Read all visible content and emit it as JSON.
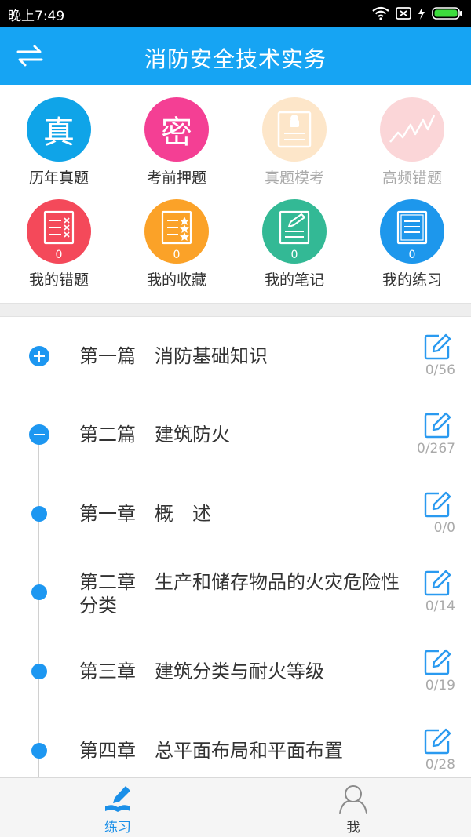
{
  "status_bar": {
    "time": "晚上7:49"
  },
  "header": {
    "title": "消防安全技术实务",
    "switch_icon": "swap-arrows-icon"
  },
  "grid": [
    {
      "label": "历年真题",
      "glyph": "真",
      "color": "#0fa4e8",
      "enabled": true
    },
    {
      "label": "考前押题",
      "glyph": "密",
      "color": "#f43f94",
      "enabled": true
    },
    {
      "label": "真题模考",
      "icon": "android-doc-icon",
      "color": "#fde6c9",
      "enabled": false
    },
    {
      "label": "高频错题",
      "icon": "trend-line-icon",
      "color": "#fbd6d8",
      "enabled": false
    },
    {
      "label": "我的错题",
      "count": "0",
      "icon": "wrong-list-icon",
      "color": "#f4495a",
      "enabled": true
    },
    {
      "label": "我的收藏",
      "count": "0",
      "icon": "star-list-icon",
      "color": "#fba228",
      "enabled": true
    },
    {
      "label": "我的笔记",
      "count": "0",
      "icon": "note-edit-icon",
      "color": "#33b995",
      "enabled": true
    },
    {
      "label": "我的练习",
      "count": "0",
      "icon": "practice-list-icon",
      "color": "#1d97ec",
      "enabled": true
    }
  ],
  "list": [
    {
      "type": "part",
      "state": "collapsed",
      "title": "第一篇　消防基础知识",
      "progress": "0/56"
    },
    {
      "type": "part",
      "state": "expanded",
      "title": "第二篇　建筑防火",
      "progress": "0/267"
    },
    {
      "type": "chapter",
      "title": "第一章　概　述",
      "progress": "0/0"
    },
    {
      "type": "chapter",
      "title": "第二章　生产和储存物品的火灾危险性分类",
      "progress": "0/14"
    },
    {
      "type": "chapter",
      "title": "第三章　建筑分类与耐火等级",
      "progress": "0/19"
    },
    {
      "type": "chapter",
      "title": "第四章　总平面布局和平面布置",
      "progress": "0/28"
    }
  ],
  "bottom_nav": [
    {
      "label": "练习",
      "icon": "pencil-book-icon",
      "active": true
    },
    {
      "label": "我",
      "icon": "user-icon",
      "active": false
    }
  ],
  "colors": {
    "header": "#16a4f3",
    "accent": "#1d97f1"
  }
}
